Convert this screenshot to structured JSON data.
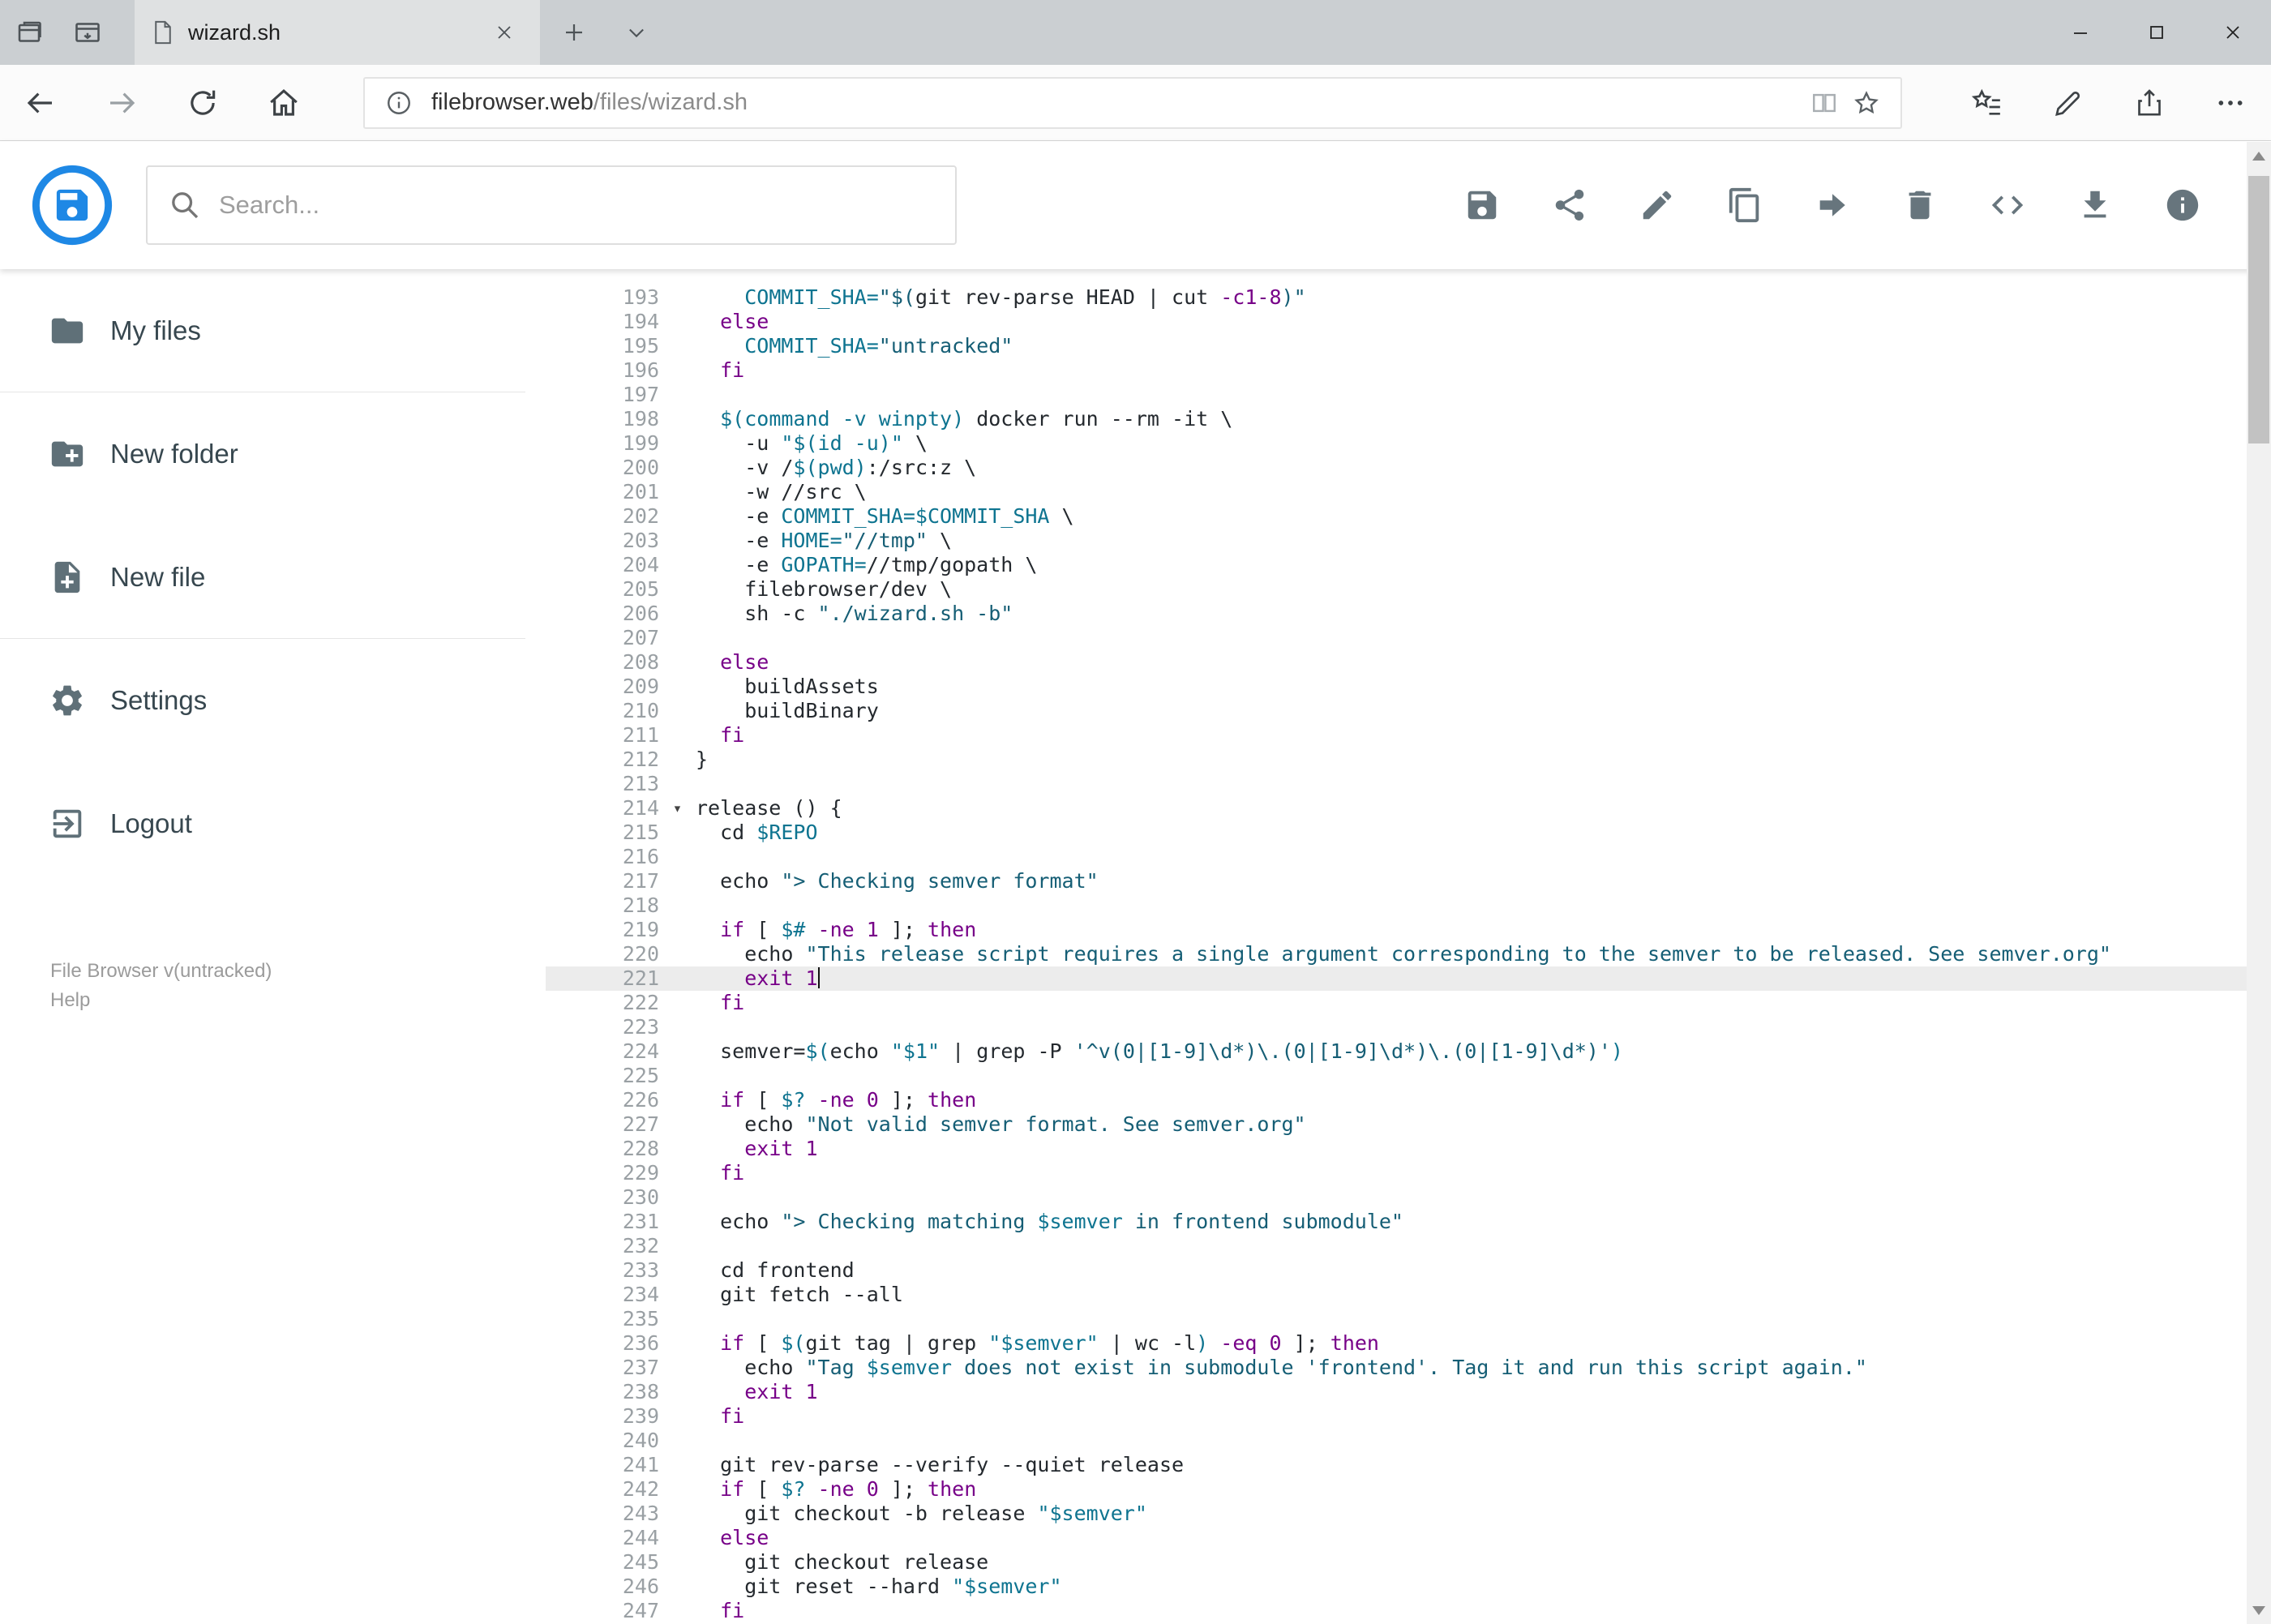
{
  "browser": {
    "tab_title": "wizard.sh",
    "url": {
      "host": "filebrowser.web",
      "path": "/files/wizard.sh"
    }
  },
  "header": {
    "search_placeholder": "Search...",
    "action_icons": [
      "save",
      "share",
      "rename",
      "copy",
      "move",
      "delete",
      "raw-editor",
      "download",
      "info"
    ]
  },
  "sidebar": {
    "items": [
      {
        "icon": "folder",
        "label": "My files"
      },
      {
        "icon": "new-folder",
        "label": "New folder"
      },
      {
        "icon": "new-file",
        "label": "New file"
      },
      {
        "icon": "settings-gear",
        "label": "Settings"
      },
      {
        "icon": "logout",
        "label": "Logout"
      }
    ],
    "version": "File Browser v(untracked)",
    "help": "Help"
  },
  "editor": {
    "active_line": 221,
    "syntax_colors": {
      "plain": "#24292e",
      "keyword": "#770088",
      "variable": "#0e7490",
      "string": "#155e75",
      "line_number": "#9aa0a4"
    },
    "lines": [
      {
        "n": 193,
        "t": [
          [
            "p",
            "    "
          ],
          [
            "v",
            "COMMIT_SHA="
          ],
          [
            "s",
            "\"$("
          ],
          [
            "p",
            "git rev-parse HEAD | cut "
          ],
          [
            "k",
            "-c1-8"
          ],
          [
            "s",
            ")\""
          ]
        ]
      },
      {
        "n": 194,
        "t": [
          [
            "p",
            "  "
          ],
          [
            "k",
            "else"
          ]
        ]
      },
      {
        "n": 195,
        "t": [
          [
            "p",
            "    "
          ],
          [
            "v",
            "COMMIT_SHA="
          ],
          [
            "s",
            "\"untracked\""
          ]
        ]
      },
      {
        "n": 196,
        "t": [
          [
            "p",
            "  "
          ],
          [
            "k",
            "fi"
          ]
        ]
      },
      {
        "n": 197,
        "t": []
      },
      {
        "n": 198,
        "t": [
          [
            "p",
            "  "
          ],
          [
            "v",
            "$(command -v winpty)"
          ],
          [
            "p",
            " docker run --rm -it \\"
          ]
        ]
      },
      {
        "n": 199,
        "t": [
          [
            "p",
            "    -u "
          ],
          [
            "v",
            "\"$(id -u)\""
          ],
          [
            "p",
            " \\"
          ]
        ]
      },
      {
        "n": 200,
        "t": [
          [
            "p",
            "    -v /"
          ],
          [
            "v",
            "$(pwd)"
          ],
          [
            "p",
            ":/src:z \\"
          ]
        ]
      },
      {
        "n": 201,
        "t": [
          [
            "p",
            "    -w //src \\"
          ]
        ]
      },
      {
        "n": 202,
        "t": [
          [
            "p",
            "    -e "
          ],
          [
            "v",
            "COMMIT_SHA=$COMMIT_SHA"
          ],
          [
            "p",
            " \\"
          ]
        ]
      },
      {
        "n": 203,
        "t": [
          [
            "p",
            "    -e "
          ],
          [
            "v",
            "HOME="
          ],
          [
            "s",
            "\"//tmp\""
          ],
          [
            "p",
            " \\"
          ]
        ]
      },
      {
        "n": 204,
        "t": [
          [
            "p",
            "    -e "
          ],
          [
            "v",
            "GOPATH="
          ],
          [
            "p",
            "//tmp/gopath \\"
          ]
        ]
      },
      {
        "n": 205,
        "t": [
          [
            "p",
            "    filebrowser/dev \\"
          ]
        ]
      },
      {
        "n": 206,
        "t": [
          [
            "p",
            "    sh -c "
          ],
          [
            "s",
            "\"./wizard.sh -b\""
          ]
        ]
      },
      {
        "n": 207,
        "t": []
      },
      {
        "n": 208,
        "t": [
          [
            "p",
            "  "
          ],
          [
            "k",
            "else"
          ]
        ]
      },
      {
        "n": 209,
        "t": [
          [
            "p",
            "    buildAssets"
          ]
        ]
      },
      {
        "n": 210,
        "t": [
          [
            "p",
            "    buildBinary"
          ]
        ]
      },
      {
        "n": 211,
        "t": [
          [
            "p",
            "  "
          ],
          [
            "k",
            "fi"
          ]
        ]
      },
      {
        "n": 212,
        "t": [
          [
            "p",
            "}"
          ]
        ]
      },
      {
        "n": 213,
        "t": []
      },
      {
        "n": 214,
        "fold": true,
        "t": [
          [
            "p",
            "release () {"
          ]
        ]
      },
      {
        "n": 215,
        "t": [
          [
            "p",
            "  cd "
          ],
          [
            "v",
            "$REPO"
          ]
        ]
      },
      {
        "n": 216,
        "t": []
      },
      {
        "n": 217,
        "t": [
          [
            "p",
            "  echo "
          ],
          [
            "s",
            "\"> Checking semver format\""
          ]
        ]
      },
      {
        "n": 218,
        "t": []
      },
      {
        "n": 219,
        "t": [
          [
            "p",
            "  "
          ],
          [
            "k",
            "if"
          ],
          [
            "p",
            " [ "
          ],
          [
            "v",
            "$#"
          ],
          [
            "p",
            " "
          ],
          [
            "k",
            "-ne"
          ],
          [
            "p",
            " "
          ],
          [
            "k",
            "1"
          ],
          [
            "p",
            " ]; "
          ],
          [
            "k",
            "then"
          ]
        ]
      },
      {
        "n": 220,
        "t": [
          [
            "p",
            "    echo "
          ],
          [
            "s",
            "\"This release script requires a single argument corresponding to the semver to be released. See semver.org\""
          ]
        ]
      },
      {
        "n": 221,
        "active": true,
        "cursor": true,
        "t": [
          [
            "p",
            "    "
          ],
          [
            "k",
            "exit"
          ],
          [
            "p",
            " "
          ],
          [
            "k",
            "1"
          ]
        ]
      },
      {
        "n": 222,
        "t": [
          [
            "p",
            "  "
          ],
          [
            "k",
            "fi"
          ]
        ]
      },
      {
        "n": 223,
        "t": []
      },
      {
        "n": 224,
        "t": [
          [
            "p",
            "  semver="
          ],
          [
            "v",
            "$("
          ],
          [
            "p",
            "echo "
          ],
          [
            "v",
            "\"$1\""
          ],
          [
            "p",
            " | grep -P "
          ],
          [
            "s",
            "'^v(0|[1-9]\\d*)\\.(0|[1-9]\\d*)\\.(0|[1-9]\\d*)'"
          ],
          [
            "v",
            ")"
          ]
        ]
      },
      {
        "n": 225,
        "t": []
      },
      {
        "n": 226,
        "t": [
          [
            "p",
            "  "
          ],
          [
            "k",
            "if"
          ],
          [
            "p",
            " [ "
          ],
          [
            "v",
            "$?"
          ],
          [
            "p",
            " "
          ],
          [
            "k",
            "-ne"
          ],
          [
            "p",
            " "
          ],
          [
            "k",
            "0"
          ],
          [
            "p",
            " ]; "
          ],
          [
            "k",
            "then"
          ]
        ]
      },
      {
        "n": 227,
        "t": [
          [
            "p",
            "    echo "
          ],
          [
            "s",
            "\"Not valid semver format. See semver.org\""
          ]
        ]
      },
      {
        "n": 228,
        "t": [
          [
            "p",
            "    "
          ],
          [
            "k",
            "exit"
          ],
          [
            "p",
            " "
          ],
          [
            "k",
            "1"
          ]
        ]
      },
      {
        "n": 229,
        "t": [
          [
            "p",
            "  "
          ],
          [
            "k",
            "fi"
          ]
        ]
      },
      {
        "n": 230,
        "t": []
      },
      {
        "n": 231,
        "t": [
          [
            "p",
            "  echo "
          ],
          [
            "s",
            "\"> Checking matching "
          ],
          [
            "v",
            "$semver"
          ],
          [
            "s",
            " in frontend submodule\""
          ]
        ]
      },
      {
        "n": 232,
        "t": []
      },
      {
        "n": 233,
        "t": [
          [
            "p",
            "  cd frontend"
          ]
        ]
      },
      {
        "n": 234,
        "t": [
          [
            "p",
            "  git fetch --all"
          ]
        ]
      },
      {
        "n": 235,
        "t": []
      },
      {
        "n": 236,
        "t": [
          [
            "p",
            "  "
          ],
          [
            "k",
            "if"
          ],
          [
            "p",
            " [ "
          ],
          [
            "v",
            "$("
          ],
          [
            "p",
            "git tag | grep "
          ],
          [
            "v",
            "\"$semver\""
          ],
          [
            "p",
            " | wc -l"
          ],
          [
            "v",
            ")"
          ],
          [
            "p",
            " "
          ],
          [
            "k",
            "-eq"
          ],
          [
            "p",
            " "
          ],
          [
            "k",
            "0"
          ],
          [
            "p",
            " ]; "
          ],
          [
            "k",
            "then"
          ]
        ]
      },
      {
        "n": 237,
        "t": [
          [
            "p",
            "    echo "
          ],
          [
            "s",
            "\"Tag "
          ],
          [
            "v",
            "$semver"
          ],
          [
            "s",
            " does not exist in submodule 'frontend'. Tag it and run this script again.\""
          ]
        ]
      },
      {
        "n": 238,
        "t": [
          [
            "p",
            "    "
          ],
          [
            "k",
            "exit"
          ],
          [
            "p",
            " "
          ],
          [
            "k",
            "1"
          ]
        ]
      },
      {
        "n": 239,
        "t": [
          [
            "p",
            "  "
          ],
          [
            "k",
            "fi"
          ]
        ]
      },
      {
        "n": 240,
        "t": []
      },
      {
        "n": 241,
        "t": [
          [
            "p",
            "  git rev-parse --verify --quiet release"
          ]
        ]
      },
      {
        "n": 242,
        "t": [
          [
            "p",
            "  "
          ],
          [
            "k",
            "if"
          ],
          [
            "p",
            " [ "
          ],
          [
            "v",
            "$?"
          ],
          [
            "p",
            " "
          ],
          [
            "k",
            "-ne"
          ],
          [
            "p",
            " "
          ],
          [
            "k",
            "0"
          ],
          [
            "p",
            " ]; "
          ],
          [
            "k",
            "then"
          ]
        ]
      },
      {
        "n": 243,
        "t": [
          [
            "p",
            "    git checkout -b release "
          ],
          [
            "v",
            "\"$semver\""
          ]
        ]
      },
      {
        "n": 244,
        "t": [
          [
            "p",
            "  "
          ],
          [
            "k",
            "else"
          ]
        ]
      },
      {
        "n": 245,
        "t": [
          [
            "p",
            "    git checkout release"
          ]
        ]
      },
      {
        "n": 246,
        "t": [
          [
            "p",
            "    git reset --hard "
          ],
          [
            "v",
            "\"$semver\""
          ]
        ]
      },
      {
        "n": 247,
        "t": [
          [
            "p",
            "  "
          ],
          [
            "k",
            "fi"
          ]
        ]
      }
    ]
  },
  "colors": {
    "brand_blue": "#1e88e5",
    "chrome_gray": "#cbcfd2",
    "icon_gray": "#67757d"
  }
}
